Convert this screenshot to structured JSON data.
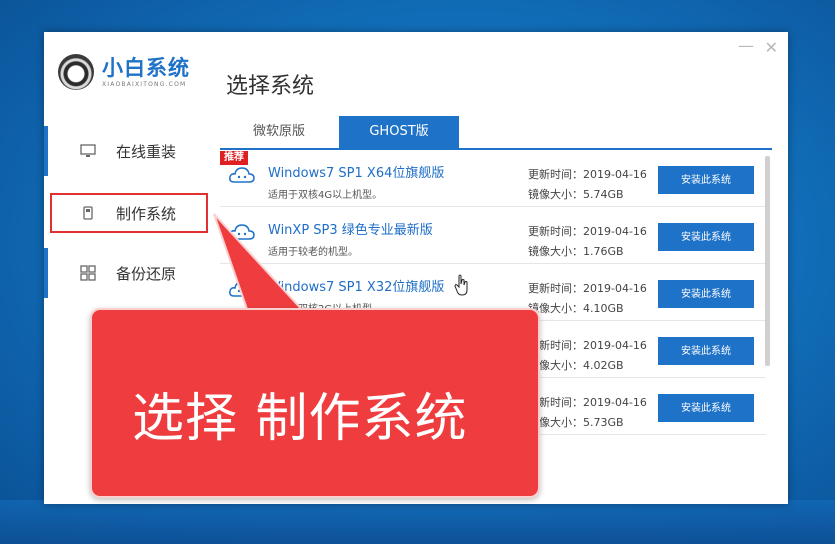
{
  "app": {
    "name": "小白系统",
    "subtitle": "XIAOBAIXITONG.COM"
  },
  "window_controls": {
    "minimize": "—",
    "close": "✕"
  },
  "page_title": "选择系统",
  "sidebar": {
    "items": [
      {
        "label": "在线重装",
        "icon": "monitor-icon"
      },
      {
        "label": "制作系统",
        "icon": "usb-drive-icon"
      },
      {
        "label": "备份还原",
        "icon": "grid-icon"
      }
    ]
  },
  "tabs": [
    {
      "label": "微软原版"
    },
    {
      "label": "GHOST版"
    }
  ],
  "list": {
    "badge": "推荐",
    "rows": [
      {
        "name": "Windows7 SP1 X64位旗舰版",
        "desc": "适用于双核4G以上机型。",
        "date": "更新时间：2019-04-16",
        "size": "镜像大小：5.74GB",
        "button": "安装此系统"
      },
      {
        "name": "WinXP SP3 绿色专业最新版",
        "desc": "适用于较老的机型。",
        "date": "更新时间：2019-04-16",
        "size": "镜像大小：1.76GB",
        "button": "安装此系统"
      },
      {
        "name": "Windows7 SP1 X32位旗舰版",
        "desc": "适用于双核2G以上机型。",
        "date": "更新时间：2019-04-16",
        "size": "镜像大小：4.10GB",
        "button": "安装此系统"
      },
      {
        "name": "",
        "desc": "",
        "date": "更新时间：2019-04-16",
        "size": "镜像大小：4.02GB",
        "button": "安装此系统"
      },
      {
        "name": "",
        "desc": "",
        "date": "更新时间：2019-04-16",
        "size": "镜像大小：5.73GB",
        "button": "安装此系统"
      }
    ]
  },
  "callout": {
    "text": "选择 制作系统"
  },
  "colors": {
    "accent": "#1e72c8",
    "callout": "#ef3d3f",
    "badge": "#e02020"
  }
}
